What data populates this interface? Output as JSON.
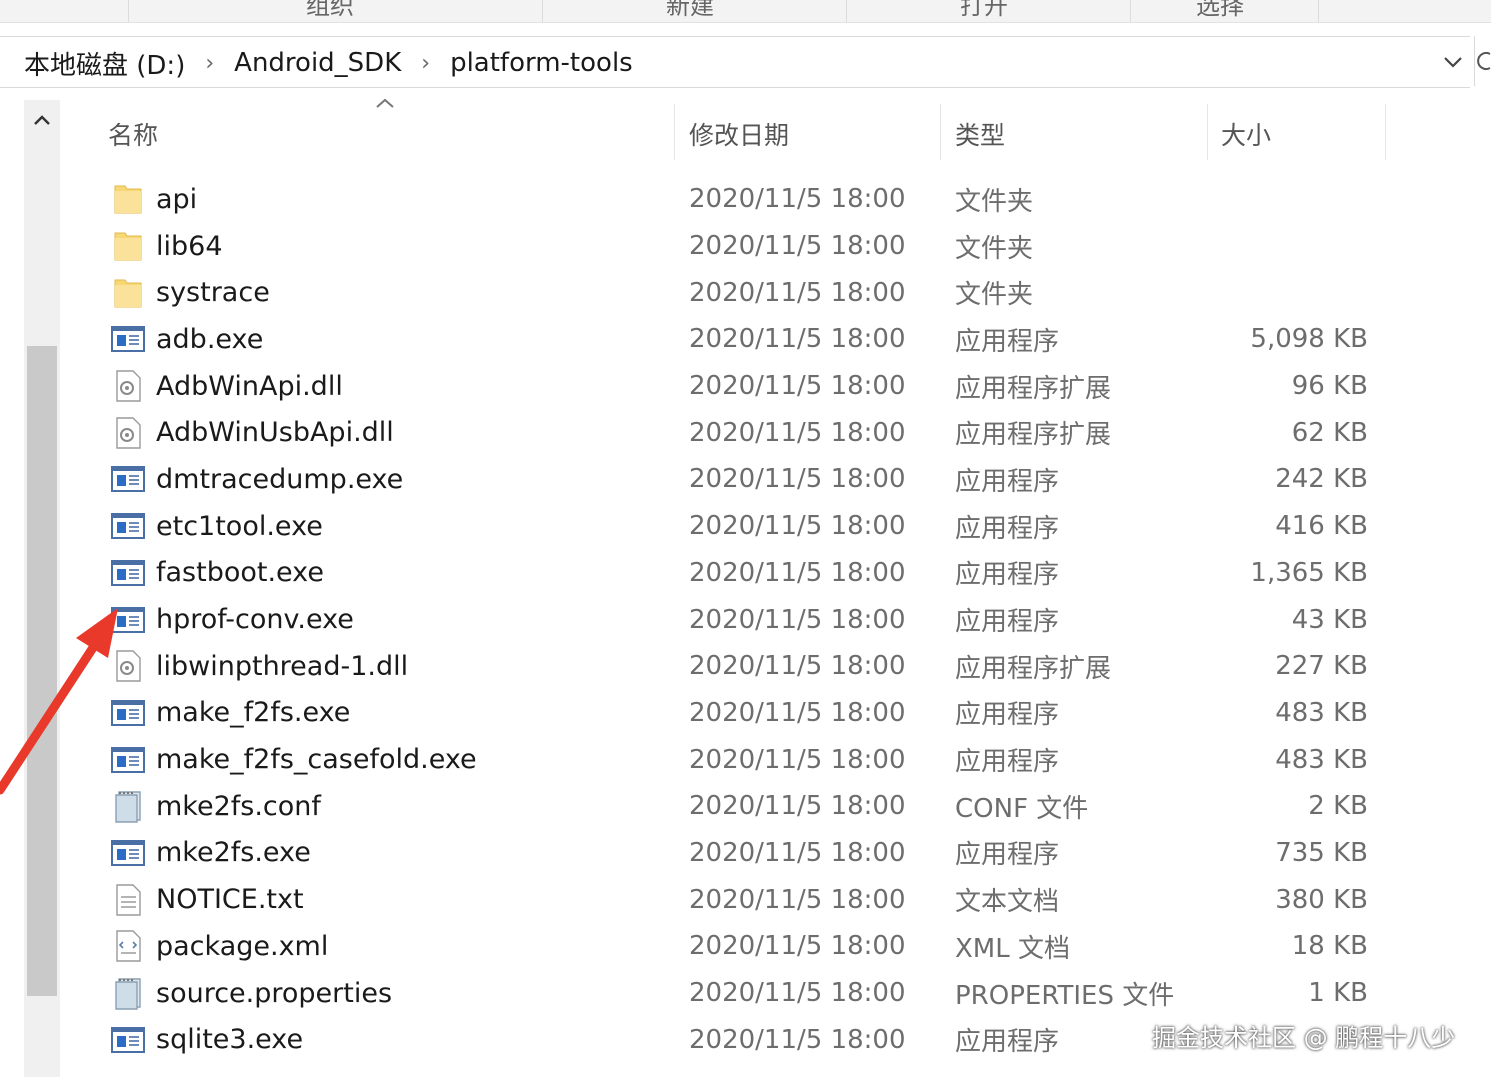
{
  "ribbon": {
    "groups": [
      "组织",
      "新建",
      "打开",
      "选择"
    ]
  },
  "breadcrumb": {
    "items": [
      "本地磁盘 (D:)",
      "Android_SDK",
      "platform-tools"
    ]
  },
  "columns": {
    "name": "名称",
    "date": "修改日期",
    "type": "类型",
    "size": "大小"
  },
  "files": [
    {
      "icon": "folder-icon",
      "name": "api",
      "date": "2020/11/5 18:00",
      "type": "文件夹",
      "size": ""
    },
    {
      "icon": "folder-icon",
      "name": "lib64",
      "date": "2020/11/5 18:00",
      "type": "文件夹",
      "size": ""
    },
    {
      "icon": "folder-icon",
      "name": "systrace",
      "date": "2020/11/5 18:00",
      "type": "文件夹",
      "size": ""
    },
    {
      "icon": "exe-icon",
      "name": "adb.exe",
      "date": "2020/11/5 18:00",
      "type": "应用程序",
      "size": "5,098 KB"
    },
    {
      "icon": "dll-icon",
      "name": "AdbWinApi.dll",
      "date": "2020/11/5 18:00",
      "type": "应用程序扩展",
      "size": "96 KB"
    },
    {
      "icon": "dll-icon",
      "name": "AdbWinUsbApi.dll",
      "date": "2020/11/5 18:00",
      "type": "应用程序扩展",
      "size": "62 KB"
    },
    {
      "icon": "exe-icon",
      "name": "dmtracedump.exe",
      "date": "2020/11/5 18:00",
      "type": "应用程序",
      "size": "242 KB"
    },
    {
      "icon": "exe-icon",
      "name": "etc1tool.exe",
      "date": "2020/11/5 18:00",
      "type": "应用程序",
      "size": "416 KB"
    },
    {
      "icon": "exe-icon",
      "name": "fastboot.exe",
      "date": "2020/11/5 18:00",
      "type": "应用程序",
      "size": "1,365 KB"
    },
    {
      "icon": "exe-icon",
      "name": "hprof-conv.exe",
      "date": "2020/11/5 18:00",
      "type": "应用程序",
      "size": "43 KB"
    },
    {
      "icon": "dll-icon",
      "name": "libwinpthread-1.dll",
      "date": "2020/11/5 18:00",
      "type": "应用程序扩展",
      "size": "227 KB"
    },
    {
      "icon": "exe-icon",
      "name": "make_f2fs.exe",
      "date": "2020/11/5 18:00",
      "type": "应用程序",
      "size": "483 KB"
    },
    {
      "icon": "exe-icon",
      "name": "make_f2fs_casefold.exe",
      "date": "2020/11/5 18:00",
      "type": "应用程序",
      "size": "483 KB"
    },
    {
      "icon": "conf-icon",
      "name": "mke2fs.conf",
      "date": "2020/11/5 18:00",
      "type": "CONF 文件",
      "size": "2 KB"
    },
    {
      "icon": "exe-icon",
      "name": "mke2fs.exe",
      "date": "2020/11/5 18:00",
      "type": "应用程序",
      "size": "735 KB"
    },
    {
      "icon": "txt-icon",
      "name": "NOTICE.txt",
      "date": "2020/11/5 18:00",
      "type": "文本文档",
      "size": "380 KB"
    },
    {
      "icon": "xml-icon",
      "name": "package.xml",
      "date": "2020/11/5 18:00",
      "type": "XML 文档",
      "size": "18 KB"
    },
    {
      "icon": "conf-icon",
      "name": "source.properties",
      "date": "2020/11/5 18:00",
      "type": "PROPERTIES 文件",
      "size": "1 KB"
    },
    {
      "icon": "exe-icon",
      "name": "sqlite3.exe",
      "date": "2020/11/5 18:00",
      "type": "应用程序",
      "size": ""
    }
  ],
  "watermark": "掘金技术社区 @ 鹏程十八少",
  "colors": {
    "folder": "#f8d775",
    "exe_blue": "#2b6cc4",
    "arrow": "#e8392b"
  }
}
